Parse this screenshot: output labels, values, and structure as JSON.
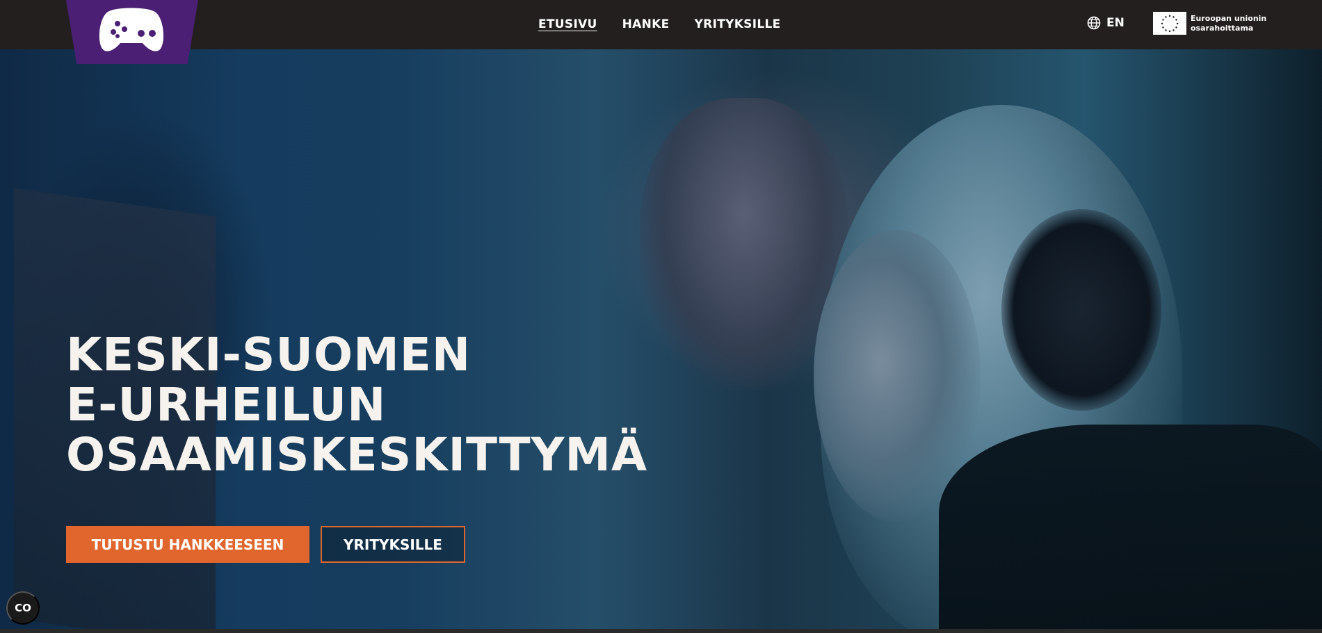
{
  "header": {
    "logo_icon": "gamepad-icon",
    "nav": [
      {
        "label": "ETUSIVU",
        "active": true
      },
      {
        "label": "HANKE",
        "active": false
      },
      {
        "label": "YRITYKSILLE",
        "active": false
      }
    ],
    "language": {
      "icon": "globe-icon",
      "label": "EN"
    },
    "eu_badge": {
      "icon": "eu-flag-icon",
      "label_line1": "Euroopan unionin",
      "label_line2": "osarahoittama"
    }
  },
  "hero": {
    "title_lines": [
      "KESKI-SUOMEN",
      "E-URHEILUN",
      "OSAAMISKESKITTYMÄ"
    ],
    "primary_button": "TUTUSTU HANKKEESEEN",
    "secondary_button": "YRITYKSILLE"
  },
  "cookie_button": {
    "label": "CO",
    "icon": "cookie-settings-icon"
  },
  "colors": {
    "header_bg": "#231f1e",
    "logo_bg": "#4a1f74",
    "accent": "#e0662e",
    "text": "#ffffff"
  }
}
